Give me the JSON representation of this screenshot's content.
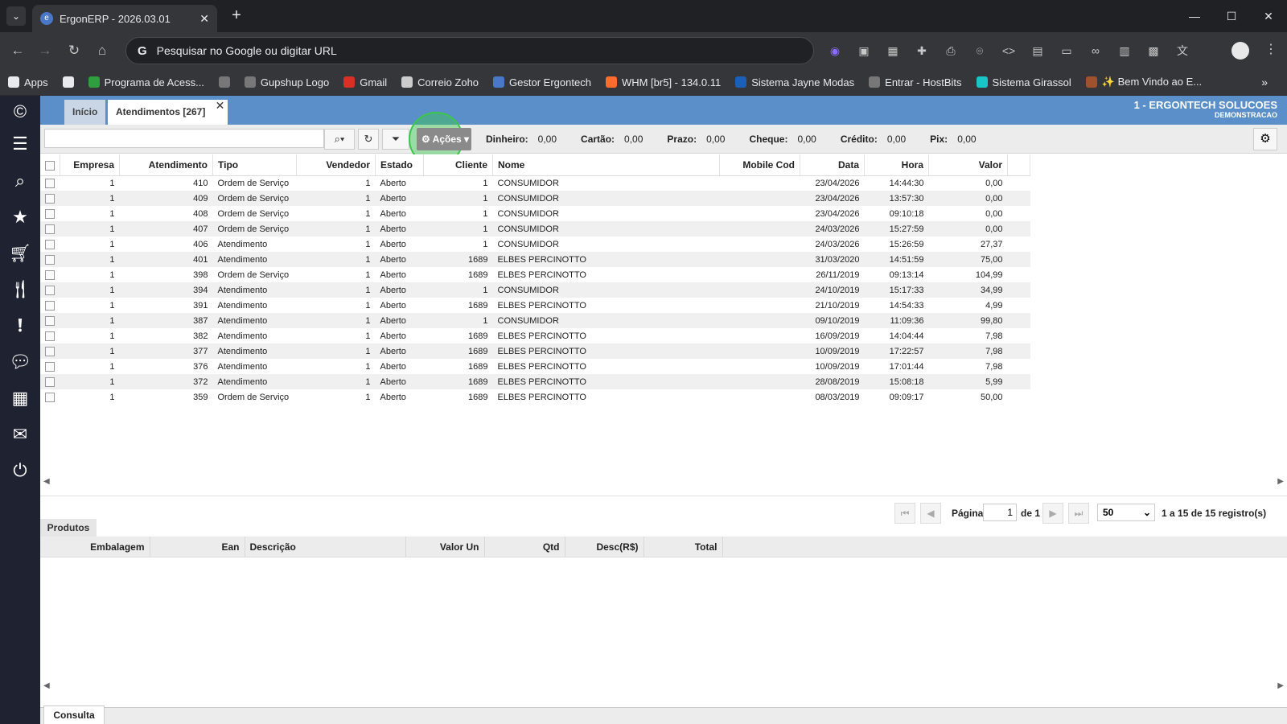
{
  "browser": {
    "tab_title": "ErgonERP - 2026.03.01",
    "omnibox_placeholder": "Pesquisar no Google ou digitar URL",
    "bookmarks": [
      {
        "label": "Apps",
        "icon": "apps-grid-icon",
        "color": "#e8eaed"
      },
      {
        "label": "",
        "icon": "tab-groups-icon",
        "color": "#e8eaed"
      },
      {
        "label": "Programa de Acess...",
        "icon": "plus-green-icon",
        "color": "#2e9e3e"
      },
      {
        "label": "",
        "icon": "globe-icon",
        "color": "#777"
      },
      {
        "label": "Gupshup Logo",
        "icon": "globe-icon",
        "color": "#777"
      },
      {
        "label": "Gmail",
        "icon": "gmail-icon",
        "color": "#d93025"
      },
      {
        "label": "Correio Zoho",
        "icon": "zoho-mail-icon",
        "color": "#ccc"
      },
      {
        "label": "Gestor Ergontech",
        "icon": "ergon-icon",
        "color": "#4a78c8"
      },
      {
        "label": "WHM [br5] - 134.0.11",
        "icon": "cpanel-icon",
        "color": "#ff6c2c"
      },
      {
        "label": "Sistema Jayne Modas",
        "icon": "j-icon",
        "color": "#1c5fb8"
      },
      {
        "label": "Entrar - HostBits",
        "icon": "globe-icon",
        "color": "#777"
      },
      {
        "label": "Sistema Girassol",
        "icon": "s-icon",
        "color": "#18c6c6"
      },
      {
        "label": "✨ Bem Vindo ao E...",
        "icon": "image-icon",
        "color": "#a0522d"
      }
    ]
  },
  "app": {
    "tabs": [
      {
        "label": "Início"
      },
      {
        "label": "Atendimentos [267]"
      }
    ],
    "company_name": "1 - ERGONTECH SOLUCOES",
    "company_sub": "DEMONSTRACAO",
    "search_value": "",
    "actions_label": "Ações",
    "totals": [
      {
        "label": "Dinheiro:",
        "value": "0,00"
      },
      {
        "label": "Cartão:",
        "value": "0,00"
      },
      {
        "label": "Prazo:",
        "value": "0,00"
      },
      {
        "label": "Cheque:",
        "value": "0,00"
      },
      {
        "label": "Crédito:",
        "value": "0,00"
      },
      {
        "label": "Pix:",
        "value": "0,00"
      }
    ],
    "columns": [
      "Empresa",
      "Atendimento",
      "Tipo",
      "Vendedor",
      "Estado",
      "Cliente",
      "Nome",
      "Mobile Cod",
      "Data",
      "Hora",
      "Valor"
    ],
    "rows": [
      [
        "1",
        "410",
        "Ordem de Serviço",
        "1",
        "Aberto",
        "1",
        "CONSUMIDOR",
        "",
        "23/04/2026",
        "14:44:30",
        "0,00"
      ],
      [
        "1",
        "409",
        "Ordem de Serviço",
        "1",
        "Aberto",
        "1",
        "CONSUMIDOR",
        "",
        "23/04/2026",
        "13:57:30",
        "0,00"
      ],
      [
        "1",
        "408",
        "Ordem de Serviço",
        "1",
        "Aberto",
        "1",
        "CONSUMIDOR",
        "",
        "23/04/2026",
        "09:10:18",
        "0,00"
      ],
      [
        "1",
        "407",
        "Ordem de Serviço",
        "1",
        "Aberto",
        "1",
        "CONSUMIDOR",
        "",
        "24/03/2026",
        "15:27:59",
        "0,00"
      ],
      [
        "1",
        "406",
        "Atendimento",
        "1",
        "Aberto",
        "1",
        "CONSUMIDOR",
        "",
        "24/03/2026",
        "15:26:59",
        "27,37"
      ],
      [
        "1",
        "401",
        "Atendimento",
        "1",
        "Aberto",
        "1689",
        "ELBES PERCINOTTO",
        "",
        "31/03/2020",
        "14:51:59",
        "75,00"
      ],
      [
        "1",
        "398",
        "Ordem de Serviço",
        "1",
        "Aberto",
        "1689",
        "ELBES PERCINOTTO",
        "",
        "26/11/2019",
        "09:13:14",
        "104,99"
      ],
      [
        "1",
        "394",
        "Atendimento",
        "1",
        "Aberto",
        "1",
        "CONSUMIDOR",
        "",
        "24/10/2019",
        "15:17:33",
        "34,99"
      ],
      [
        "1",
        "391",
        "Atendimento",
        "1",
        "Aberto",
        "1689",
        "ELBES PERCINOTTO",
        "",
        "21/10/2019",
        "14:54:33",
        "4,99"
      ],
      [
        "1",
        "387",
        "Atendimento",
        "1",
        "Aberto",
        "1",
        "CONSUMIDOR",
        "",
        "09/10/2019",
        "11:09:36",
        "99,80"
      ],
      [
        "1",
        "382",
        "Atendimento",
        "1",
        "Aberto",
        "1689",
        "ELBES PERCINOTTO",
        "",
        "16/09/2019",
        "14:04:44",
        "7,98"
      ],
      [
        "1",
        "377",
        "Atendimento",
        "1",
        "Aberto",
        "1689",
        "ELBES PERCINOTTO",
        "",
        "10/09/2019",
        "17:22:57",
        "7,98"
      ],
      [
        "1",
        "376",
        "Atendimento",
        "1",
        "Aberto",
        "1689",
        "ELBES PERCINOTTO",
        "",
        "10/09/2019",
        "17:01:44",
        "7,98"
      ],
      [
        "1",
        "372",
        "Atendimento",
        "1",
        "Aberto",
        "1689",
        "ELBES PERCINOTTO",
        "",
        "28/08/2019",
        "15:08:18",
        "5,99"
      ],
      [
        "1",
        "359",
        "Ordem de Serviço",
        "1",
        "Aberto",
        "1689",
        "ELBES PERCINOTTO",
        "",
        "08/03/2019",
        "09:09:17",
        "50,00"
      ]
    ],
    "pager": {
      "page_label": "Página",
      "page_value": "1",
      "of_label": "de 1",
      "page_size": "50",
      "summary": "1 a 15 de 15 registro(s)"
    },
    "products_tab": "Produtos",
    "product_columns": [
      "Embalagem",
      "Ean",
      "Descrição",
      "Valor Un",
      "Qtd",
      "Desc(R$)",
      "Total"
    ],
    "bottom_tab": "Consulta"
  },
  "colors": {
    "header_blue": "#5b8fc9",
    "sidebar_dark": "#1f2230",
    "actions_highlight": "#3cc74a"
  }
}
